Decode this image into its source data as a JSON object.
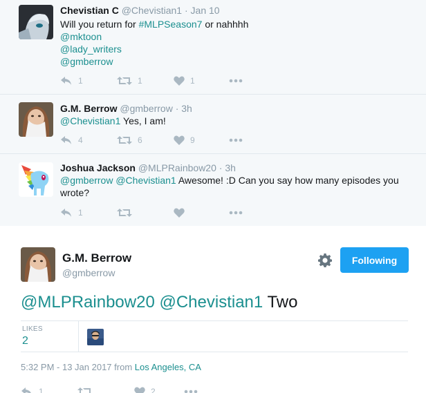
{
  "replies": [
    {
      "fullname": "Chevistian C",
      "handle": "@Chevistian1",
      "time": "Jan 10",
      "text_parts": [
        "Will you return for ",
        "#MLPSeason7",
        " or nahhhh"
      ],
      "mentions": [
        "@mktoon",
        "@lady_writers",
        "@gmberrow"
      ],
      "replies": "1",
      "retweets": "1",
      "likes": "1"
    },
    {
      "fullname": "G.M. Berrow",
      "handle": "@gmberrow",
      "time": "3h",
      "mention": "@Chevistian1",
      "text": " Yes, I am!",
      "replies": "4",
      "retweets": "6",
      "likes": "9"
    },
    {
      "fullname": "Joshua Jackson",
      "handle": "@MLPRainbow20",
      "time": "3h",
      "mention1": "@gmberrow",
      "mention2": "@Chevistian1",
      "text_line1": " Awesome! :D Can you say how many episodes you",
      "text_line2": "wrote?",
      "replies": "1"
    }
  ],
  "main": {
    "fullname": "G.M. Berrow",
    "handle": "@gmberrow",
    "follow_label": "Following",
    "mention1": "@MLPRainbow20",
    "mention2": "@Chevistian1",
    "text": " Two",
    "likes_label": "LIKES",
    "likes_count": "2",
    "timestamp": "5:32 PM - 13 Jan 2017 from ",
    "location": "Los Angeles, CA",
    "replies": "1",
    "likes": "2"
  },
  "colors": {
    "accent": "#1b8f8f",
    "follow_button": "#1da1f2",
    "reply_background": "#f5f8fa",
    "action_gray": "#aab8c2"
  },
  "separator": " · "
}
